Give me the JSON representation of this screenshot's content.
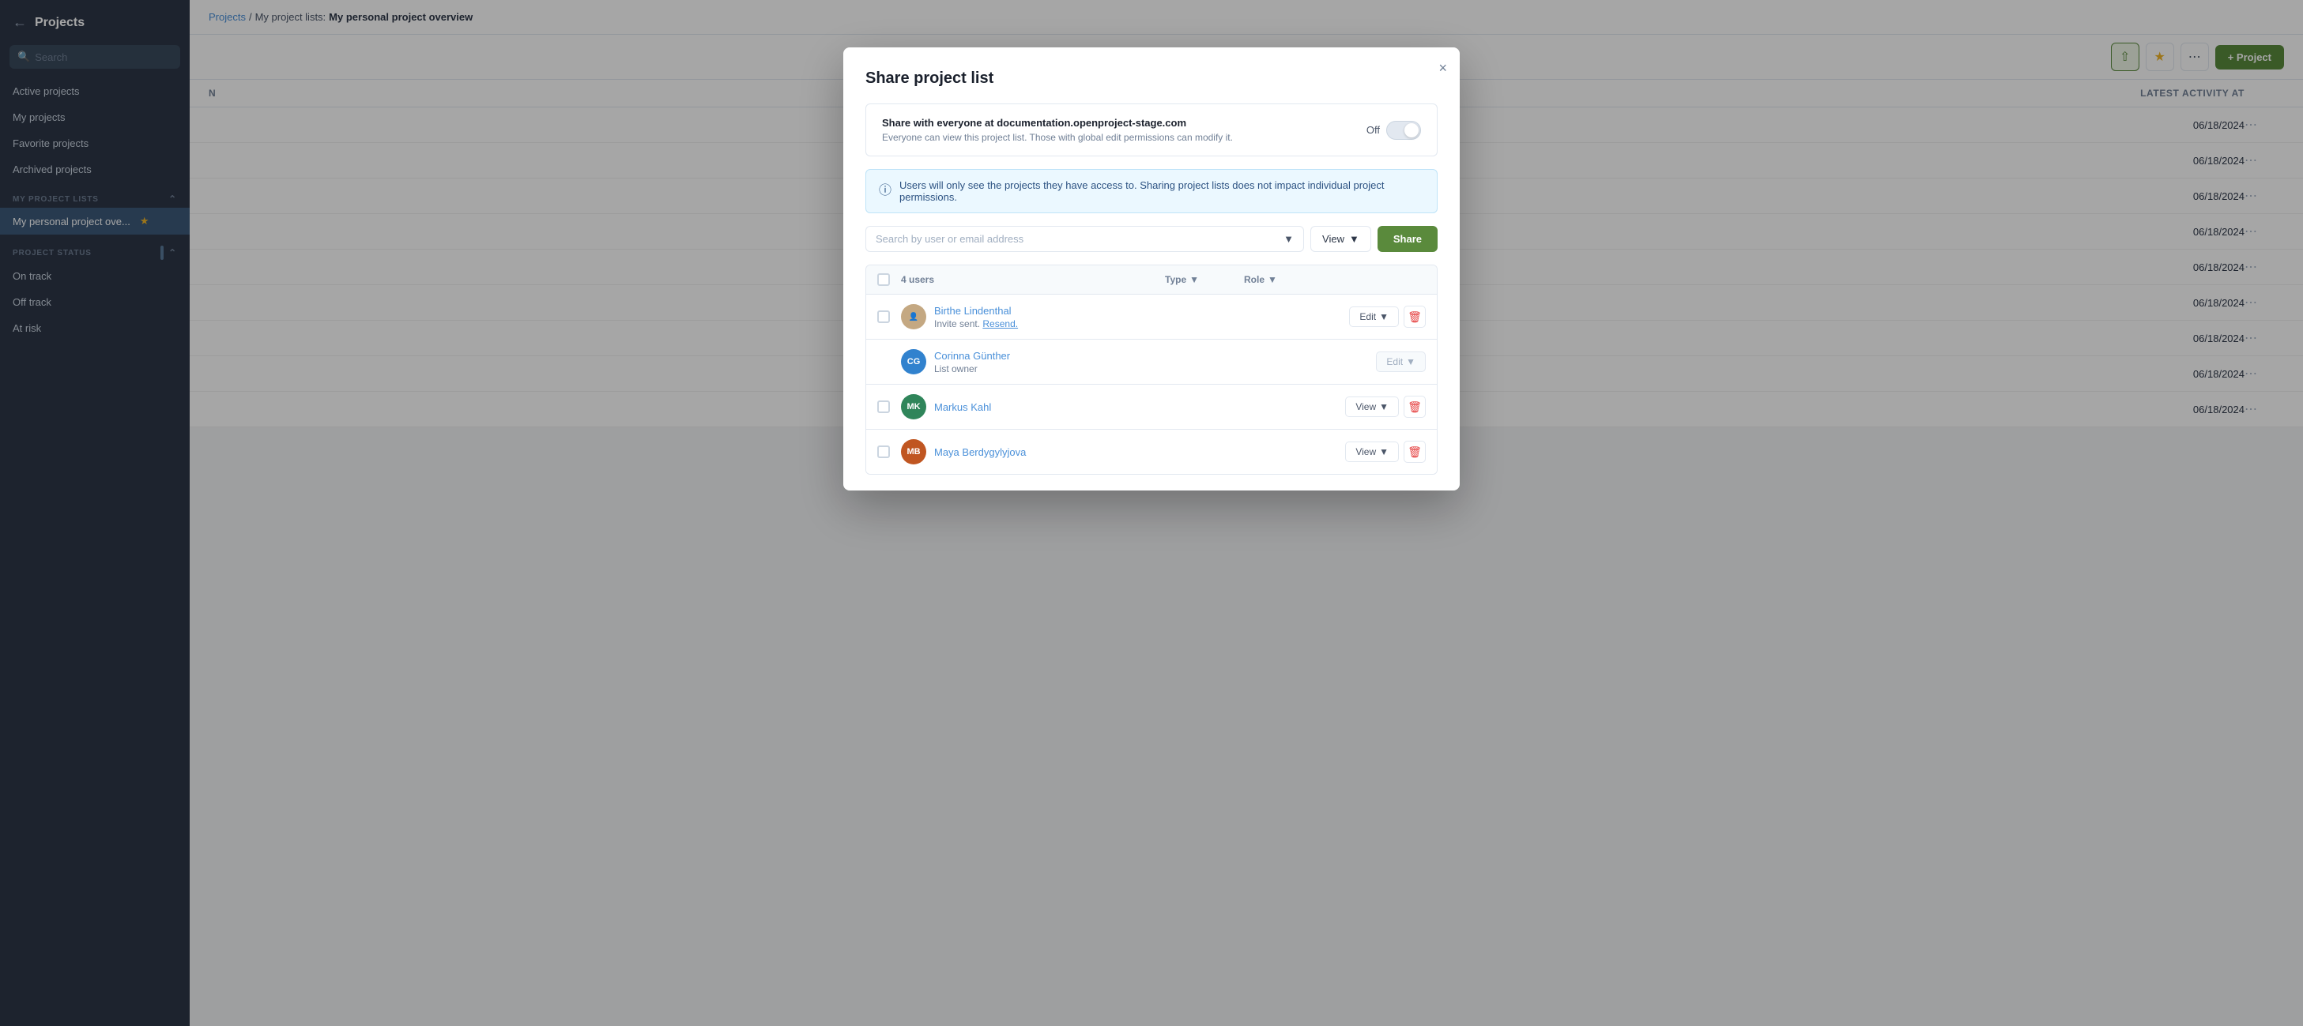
{
  "sidebar": {
    "back_label": "Projects",
    "search_placeholder": "Search",
    "nav_items": [
      {
        "id": "active",
        "label": "Active projects"
      },
      {
        "id": "my",
        "label": "My projects"
      },
      {
        "id": "favorite",
        "label": "Favorite projects"
      },
      {
        "id": "archived",
        "label": "Archived projects"
      }
    ],
    "my_project_lists_label": "MY PROJECT LISTS",
    "personal_list_label": "My personal project ove...",
    "project_status_label": "PROJECT STATUS",
    "status_items": [
      {
        "id": "on-track",
        "label": "On track"
      },
      {
        "id": "off-track",
        "label": "Off track"
      },
      {
        "id": "at-risk",
        "label": "At risk"
      }
    ]
  },
  "breadcrumb": {
    "projects_label": "Projects",
    "separator": "/",
    "list_label": "My project lists:",
    "current_label": "My personal project overview"
  },
  "toolbar": {
    "share_icon": "⇧",
    "star_icon": "★",
    "dots_icon": "⋯",
    "add_project_label": "+ Project"
  },
  "table": {
    "col_name": "N",
    "col_activity": "LATEST ACTIVITY AT",
    "rows": [
      {
        "activity": "06/18/2024"
      },
      {
        "activity": "06/18/2024"
      },
      {
        "activity": "06/18/2024"
      },
      {
        "activity": "06/18/2024"
      },
      {
        "activity": "06/18/2024"
      },
      {
        "activity": "06/18/2024"
      },
      {
        "activity": "06/18/2024"
      },
      {
        "activity": "06/18/2024"
      },
      {
        "activity": "06/18/2024"
      }
    ]
  },
  "modal": {
    "title": "Share project list",
    "close_icon": "×",
    "toggle_section": {
      "label": "Share with everyone at documentation.openproject-stage.com",
      "description": "Everyone can view this project list. Those with global edit permissions can modify it.",
      "off_label": "Off"
    },
    "info_text": "Users will only see the projects they have access to. Sharing project lists does not impact individual project permissions.",
    "search_placeholder": "Search by user or email address",
    "view_label": "View",
    "share_button": "Share",
    "users_count": "4 users",
    "col_type": "Type",
    "col_role": "Role",
    "users": [
      {
        "id": "birthe",
        "name": "Birthe Lindenthal",
        "sub": "Invite sent.",
        "resend": "Resend.",
        "avatar_initials": "",
        "avatar_color": "#c4a882",
        "has_image": true,
        "action": "Edit",
        "action_disabled": false,
        "has_delete": true,
        "has_checkbox": true
      },
      {
        "id": "corinna",
        "name": "Corinna Günther",
        "sub": "List owner",
        "resend": "",
        "avatar_initials": "CG",
        "avatar_color": "#3182ce",
        "has_image": false,
        "action": "Edit",
        "action_disabled": true,
        "has_delete": false,
        "has_checkbox": false
      },
      {
        "id": "markus",
        "name": "Markus Kahl",
        "sub": "",
        "resend": "",
        "avatar_initials": "MK",
        "avatar_color": "#2f855a",
        "has_image": false,
        "action": "View",
        "action_disabled": false,
        "has_delete": true,
        "has_checkbox": true
      },
      {
        "id": "maya",
        "name": "Maya Berdygylyjova",
        "sub": "",
        "resend": "",
        "avatar_initials": "MB",
        "avatar_color": "#c05621",
        "has_image": false,
        "action": "View",
        "action_disabled": false,
        "has_delete": true,
        "has_checkbox": true
      }
    ]
  }
}
